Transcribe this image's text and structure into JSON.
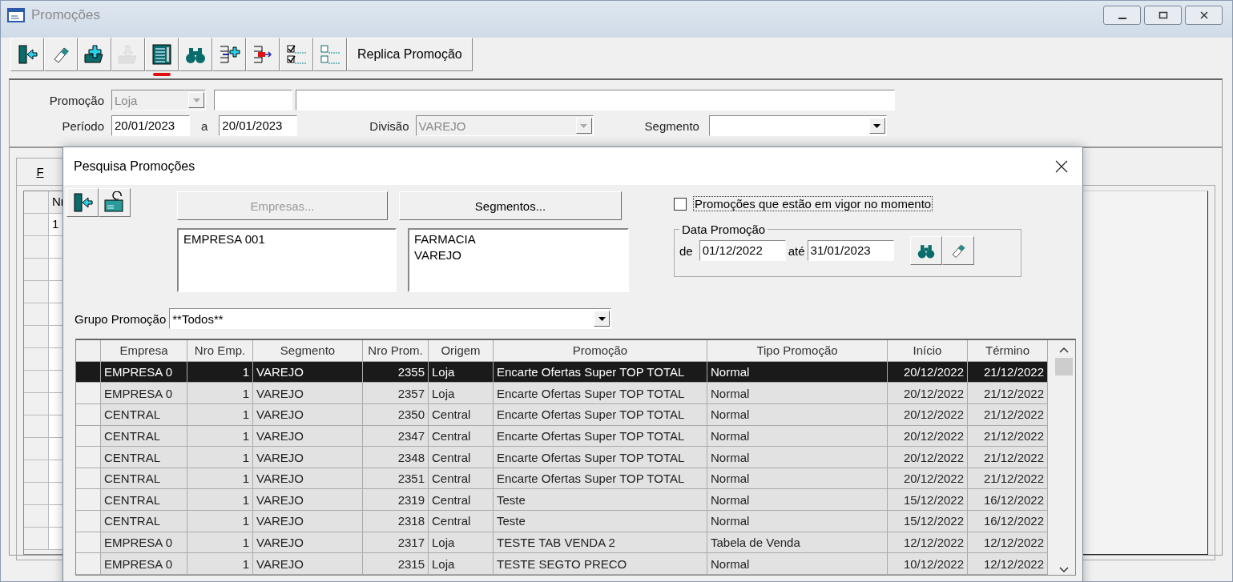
{
  "window": {
    "title": "Promoções"
  },
  "toolbar": [
    {
      "kind": "icon",
      "disabled": false,
      "highlighted": false
    },
    {
      "kind": "icon",
      "disabled": false,
      "highlighted": false
    },
    {
      "kind": "icon",
      "disabled": false,
      "highlighted": false
    },
    {
      "kind": "icon",
      "disabled": true,
      "highlighted": false
    },
    {
      "kind": "icon",
      "disabled": false,
      "highlighted": true
    },
    {
      "kind": "icon",
      "disabled": false,
      "highlighted": false
    },
    {
      "kind": "icon",
      "disabled": false,
      "highlighted": false
    },
    {
      "kind": "icon",
      "disabled": false,
      "highlighted": false
    },
    {
      "kind": "icon",
      "disabled": false,
      "highlighted": false
    },
    {
      "kind": "icon",
      "disabled": false,
      "highlighted": false
    },
    {
      "kind": "text",
      "label": "Replica Promoção",
      "disabled": false,
      "highlighted": false
    }
  ],
  "form": {
    "promocao_label": "Promoção",
    "promocao_value": "Loja",
    "periodo_label": "Período",
    "periodo_from": "20/01/2023",
    "periodo_sep": "a",
    "periodo_to": "20/01/2023",
    "divisao_label": "Divisão",
    "divisao_value": "VAREJO",
    "segmento_label": "Segmento"
  },
  "background_tab": {
    "label": "F"
  },
  "background_grid": {
    "column_1": "Nr",
    "row_1": "1"
  },
  "dialog": {
    "title": "Pesquisa Promoções",
    "empresas_button": {
      "label": "Empresas...",
      "disabled": true
    },
    "segmentos_button": {
      "label": "Segmentos...",
      "disabled": false
    },
    "empresas_list": [
      "EMPRESA 001"
    ],
    "segmentos_list": [
      "FARMACIA",
      "VAREJO"
    ],
    "grupo_label": "Grupo Promoção",
    "grupo_value": "**Todos**",
    "vigor_checkbox": {
      "label": "Promoções que estão em vigor no momento",
      "checked": false
    },
    "data_group": {
      "title": "Data Promoção",
      "from_label": "de",
      "from": "01/12/2022",
      "to_label": "até",
      "to": "31/01/2023"
    },
    "table": {
      "columns": [
        {
          "label": "Empresa",
          "kind": "text"
        },
        {
          "label": "Nro Emp.",
          "kind": "number"
        },
        {
          "label": "Segmento",
          "kind": "text"
        },
        {
          "label": "Nro Prom.",
          "kind": "number"
        },
        {
          "label": "Origem",
          "kind": "text"
        },
        {
          "label": "Promoção",
          "kind": "text"
        },
        {
          "label": "Tipo Promoção",
          "kind": "text"
        },
        {
          "label": "Início",
          "kind": "number"
        },
        {
          "label": "Término",
          "kind": "number"
        }
      ],
      "rows": [
        {
          "selected": true,
          "cells": [
            "EMPRESA 0",
            "1",
            "VAREJO",
            "2355",
            "Loja",
            "Encarte Ofertas Super TOP TOTAL",
            "Normal",
            "20/12/2022",
            "21/12/2022"
          ]
        },
        {
          "selected": false,
          "cells": [
            "EMPRESA 0",
            "1",
            "VAREJO",
            "2357",
            "Loja",
            "Encarte Ofertas Super TOP TOTAL",
            "Normal",
            "20/12/2022",
            "21/12/2022"
          ]
        },
        {
          "selected": false,
          "cells": [
            "CENTRAL",
            "1",
            "VAREJO",
            "2350",
            "Central",
            "Encarte Ofertas Super TOP TOTAL",
            "Normal",
            "20/12/2022",
            "21/12/2022"
          ]
        },
        {
          "selected": false,
          "cells": [
            "CENTRAL",
            "1",
            "VAREJO",
            "2347",
            "Central",
            "Encarte Ofertas Super TOP TOTAL",
            "Normal",
            "20/12/2022",
            "21/12/2022"
          ]
        },
        {
          "selected": false,
          "cells": [
            "CENTRAL",
            "1",
            "VAREJO",
            "2348",
            "Central",
            "Encarte Ofertas Super TOP TOTAL",
            "Normal",
            "20/12/2022",
            "21/12/2022"
          ]
        },
        {
          "selected": false,
          "cells": [
            "CENTRAL",
            "1",
            "VAREJO",
            "2351",
            "Central",
            "Encarte Ofertas Super TOP TOTAL",
            "Normal",
            "20/12/2022",
            "21/12/2022"
          ]
        },
        {
          "selected": false,
          "cells": [
            "CENTRAL",
            "1",
            "VAREJO",
            "2319",
            "Central",
            "Teste",
            "Normal",
            "15/12/2022",
            "16/12/2022"
          ]
        },
        {
          "selected": false,
          "cells": [
            "CENTRAL",
            "1",
            "VAREJO",
            "2318",
            "Central",
            "Teste",
            "Normal",
            "15/12/2022",
            "16/12/2022"
          ]
        },
        {
          "selected": false,
          "cells": [
            "EMPRESA 0",
            "1",
            "VAREJO",
            "2317",
            "Loja",
            "TESTE TAB VENDA 2",
            "Tabela de Venda",
            "12/12/2022",
            "12/12/2022"
          ]
        },
        {
          "selected": false,
          "cells": [
            "EMPRESA 0",
            "1",
            "VAREJO",
            "2315",
            "Loja",
            "TESTE SEGTO PRECO",
            "Normal",
            "10/12/2022",
            "12/12/2022"
          ]
        }
      ]
    }
  }
}
